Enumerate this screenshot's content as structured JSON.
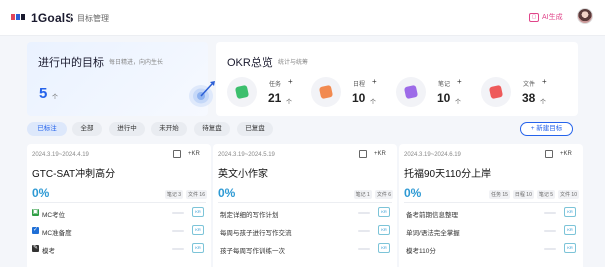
{
  "header": {
    "brand": "1GoalS",
    "module": "目标管理",
    "ai_label": "AI生成"
  },
  "goals_panel": {
    "title": "进行中的目标",
    "subtitle": "每日精进，向内生长",
    "count": "5",
    "unit": "个"
  },
  "okr_panel": {
    "title": "OKR总览",
    "subtitle": "统计与统筹",
    "stats": [
      {
        "label": "任务",
        "value": "21",
        "unit": "个",
        "color": "#3cbf6d"
      },
      {
        "label": "日程",
        "value": "10",
        "unit": "个",
        "color": "#f28a50"
      },
      {
        "label": "笔记",
        "value": "10",
        "unit": "个",
        "color": "#9d6be8"
      },
      {
        "label": "文件",
        "value": "38",
        "unit": "个",
        "color": "#ee5a5a"
      }
    ],
    "plus": "+"
  },
  "filters": [
    "已标注",
    "全部",
    "进行中",
    "未开始",
    "待复盘",
    "已复盘"
  ],
  "new_goal_label": "+ 新建目标",
  "cards": [
    {
      "date": "2024.3.19~2024.4.19",
      "kr": "+KR",
      "name": "GTC-SAT冲刺高分",
      "progress": "0%",
      "badges": [
        "笔记 3",
        "文件 16"
      ],
      "krs": [
        {
          "text": "MC考位",
          "icon": "#2f9e44",
          "tag": "KR"
        },
        {
          "text": "MC准备度",
          "icon": "#1f6fd6",
          "tag": "KR"
        },
        {
          "text": "模考",
          "icon": "#333333",
          "tag": "KR"
        }
      ]
    },
    {
      "date": "2024.3.19~2024.5.19",
      "kr": "+KR",
      "name": "英文小作家",
      "progress": "0%",
      "badges": [
        "笔记 1",
        "文件 6"
      ],
      "krs": [
        {
          "text": "制定详细的写作计划",
          "tag": "KR"
        },
        {
          "text": "每周与孩子进行写作交流",
          "tag": "KR"
        },
        {
          "text": "孩子每周写作训练一次",
          "tag": "KR"
        }
      ]
    },
    {
      "date": "2024.3.19~2024.6.19",
      "kr": "+KR",
      "name": "托福90天110分上岸",
      "progress": "0%",
      "badges": [
        "任务 15",
        "日程 10",
        "笔记 5",
        "文件 10"
      ],
      "krs": [
        {
          "text": "备考前期信息整理",
          "tag": "KR"
        },
        {
          "text": "单词/语法完全掌握",
          "tag": "KR"
        },
        {
          "text": "模考110分",
          "tag": "KR"
        }
      ]
    }
  ]
}
